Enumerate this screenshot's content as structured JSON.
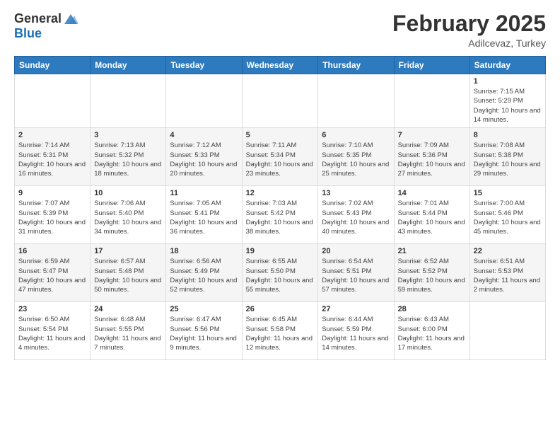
{
  "header": {
    "logo_general": "General",
    "logo_blue": "Blue",
    "month": "February 2025",
    "location": "Adilcevaz, Turkey"
  },
  "columns": [
    "Sunday",
    "Monday",
    "Tuesday",
    "Wednesday",
    "Thursday",
    "Friday",
    "Saturday"
  ],
  "weeks": [
    {
      "days": [
        {
          "num": "",
          "info": ""
        },
        {
          "num": "",
          "info": ""
        },
        {
          "num": "",
          "info": ""
        },
        {
          "num": "",
          "info": ""
        },
        {
          "num": "",
          "info": ""
        },
        {
          "num": "",
          "info": ""
        },
        {
          "num": "1",
          "info": "Sunrise: 7:15 AM\nSunset: 5:29 PM\nDaylight: 10 hours and 14 minutes."
        }
      ]
    },
    {
      "days": [
        {
          "num": "2",
          "info": "Sunrise: 7:14 AM\nSunset: 5:31 PM\nDaylight: 10 hours and 16 minutes."
        },
        {
          "num": "3",
          "info": "Sunrise: 7:13 AM\nSunset: 5:32 PM\nDaylight: 10 hours and 18 minutes."
        },
        {
          "num": "4",
          "info": "Sunrise: 7:12 AM\nSunset: 5:33 PM\nDaylight: 10 hours and 20 minutes."
        },
        {
          "num": "5",
          "info": "Sunrise: 7:11 AM\nSunset: 5:34 PM\nDaylight: 10 hours and 23 minutes."
        },
        {
          "num": "6",
          "info": "Sunrise: 7:10 AM\nSunset: 5:35 PM\nDaylight: 10 hours and 25 minutes."
        },
        {
          "num": "7",
          "info": "Sunrise: 7:09 AM\nSunset: 5:36 PM\nDaylight: 10 hours and 27 minutes."
        },
        {
          "num": "8",
          "info": "Sunrise: 7:08 AM\nSunset: 5:38 PM\nDaylight: 10 hours and 29 minutes."
        }
      ]
    },
    {
      "days": [
        {
          "num": "9",
          "info": "Sunrise: 7:07 AM\nSunset: 5:39 PM\nDaylight: 10 hours and 31 minutes."
        },
        {
          "num": "10",
          "info": "Sunrise: 7:06 AM\nSunset: 5:40 PM\nDaylight: 10 hours and 34 minutes."
        },
        {
          "num": "11",
          "info": "Sunrise: 7:05 AM\nSunset: 5:41 PM\nDaylight: 10 hours and 36 minutes."
        },
        {
          "num": "12",
          "info": "Sunrise: 7:03 AM\nSunset: 5:42 PM\nDaylight: 10 hours and 38 minutes."
        },
        {
          "num": "13",
          "info": "Sunrise: 7:02 AM\nSunset: 5:43 PM\nDaylight: 10 hours and 40 minutes."
        },
        {
          "num": "14",
          "info": "Sunrise: 7:01 AM\nSunset: 5:44 PM\nDaylight: 10 hours and 43 minutes."
        },
        {
          "num": "15",
          "info": "Sunrise: 7:00 AM\nSunset: 5:46 PM\nDaylight: 10 hours and 45 minutes."
        }
      ]
    },
    {
      "days": [
        {
          "num": "16",
          "info": "Sunrise: 6:59 AM\nSunset: 5:47 PM\nDaylight: 10 hours and 47 minutes."
        },
        {
          "num": "17",
          "info": "Sunrise: 6:57 AM\nSunset: 5:48 PM\nDaylight: 10 hours and 50 minutes."
        },
        {
          "num": "18",
          "info": "Sunrise: 6:56 AM\nSunset: 5:49 PM\nDaylight: 10 hours and 52 minutes."
        },
        {
          "num": "19",
          "info": "Sunrise: 6:55 AM\nSunset: 5:50 PM\nDaylight: 10 hours and 55 minutes."
        },
        {
          "num": "20",
          "info": "Sunrise: 6:54 AM\nSunset: 5:51 PM\nDaylight: 10 hours and 57 minutes."
        },
        {
          "num": "21",
          "info": "Sunrise: 6:52 AM\nSunset: 5:52 PM\nDaylight: 10 hours and 59 minutes."
        },
        {
          "num": "22",
          "info": "Sunrise: 6:51 AM\nSunset: 5:53 PM\nDaylight: 11 hours and 2 minutes."
        }
      ]
    },
    {
      "days": [
        {
          "num": "23",
          "info": "Sunrise: 6:50 AM\nSunset: 5:54 PM\nDaylight: 11 hours and 4 minutes."
        },
        {
          "num": "24",
          "info": "Sunrise: 6:48 AM\nSunset: 5:55 PM\nDaylight: 11 hours and 7 minutes."
        },
        {
          "num": "25",
          "info": "Sunrise: 6:47 AM\nSunset: 5:56 PM\nDaylight: 11 hours and 9 minutes."
        },
        {
          "num": "26",
          "info": "Sunrise: 6:45 AM\nSunset: 5:58 PM\nDaylight: 11 hours and 12 minutes."
        },
        {
          "num": "27",
          "info": "Sunrise: 6:44 AM\nSunset: 5:59 PM\nDaylight: 11 hours and 14 minutes."
        },
        {
          "num": "28",
          "info": "Sunrise: 6:43 AM\nSunset: 6:00 PM\nDaylight: 11 hours and 17 minutes."
        },
        {
          "num": "",
          "info": ""
        }
      ]
    }
  ]
}
